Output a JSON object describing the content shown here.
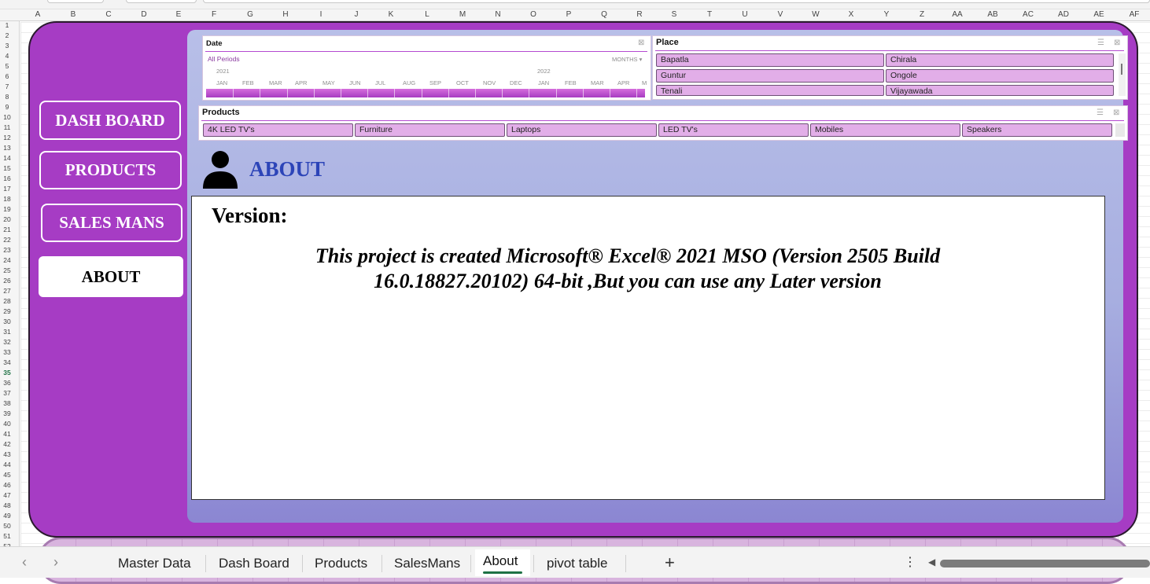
{
  "columns": [
    "A",
    "B",
    "C",
    "D",
    "E",
    "F",
    "G",
    "H",
    "I",
    "J",
    "K",
    "L",
    "M",
    "N",
    "O",
    "P",
    "Q",
    "R",
    "S",
    "T",
    "U",
    "V",
    "W",
    "X",
    "Y",
    "Z",
    "AA",
    "AB",
    "AC",
    "AD",
    "AE",
    "AF"
  ],
  "rows": [
    "1",
    "2",
    "3",
    "4",
    "5",
    "6",
    "7",
    "8",
    "9",
    "10",
    "11",
    "12",
    "13",
    "14",
    "15",
    "16",
    "17",
    "18",
    "19",
    "20",
    "21",
    "22",
    "23",
    "24",
    "25",
    "26",
    "27",
    "28",
    "29",
    "30",
    "31",
    "32",
    "33",
    "34",
    "35",
    "36",
    "37",
    "38",
    "39",
    "40",
    "41",
    "42",
    "43",
    "44",
    "45",
    "46",
    "47",
    "48",
    "49",
    "50",
    "51",
    "52"
  ],
  "selected_row": "35",
  "nav": {
    "dashboard": "DASH BOARD",
    "products": "PRODUCTS",
    "salesmans": "SALES MANS",
    "about": "ABOUT"
  },
  "date_slicer": {
    "title": "Date",
    "period": "All Periods",
    "level": "MONTHS",
    "year1": "2021",
    "year2": "2022",
    "months": [
      "JAN",
      "FEB",
      "MAR",
      "APR",
      "MAY",
      "JUN",
      "JUL",
      "AUG",
      "SEP",
      "OCT",
      "NOV",
      "DEC",
      "JAN",
      "FEB",
      "MAR",
      "APR",
      "M"
    ]
  },
  "place_slicer": {
    "title": "Place",
    "items": [
      "Bapatla",
      "Chirala",
      "Guntur",
      "Ongole",
      "Tenali",
      "Vijayawada"
    ]
  },
  "products_slicer": {
    "title": "Products",
    "items": [
      "4K LED TV's",
      "Furniture",
      "Laptops",
      "LED TV's",
      "Mobiles",
      "Speakers"
    ]
  },
  "about": {
    "title": "ABOUT",
    "version_label": "Version:",
    "version_line1": "This project is created Microsoft® Excel® 2021 MSO (Version 2505 Build",
    "version_line2": "16.0.18827.20102) 64-bit ,But you can use any Later version"
  },
  "sheet_tabs": [
    "Master Data",
    "Dash Board",
    "Products",
    "SalesMans",
    "About",
    "pivot table"
  ],
  "active_tab": "About",
  "colors": {
    "frame": "#a63cc4",
    "panel_top": "#b8bfe8",
    "panel_bottom": "#8b86d2",
    "about_title": "#2c44b8",
    "chip": "#e2aee8",
    "tab_underline": "#1e7145"
  }
}
